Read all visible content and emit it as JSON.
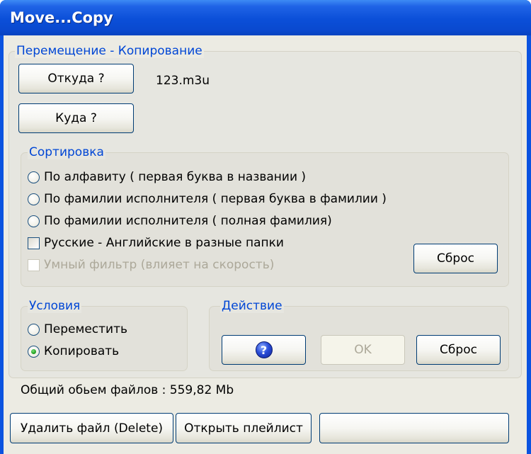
{
  "window": {
    "title": "Move...Copy"
  },
  "move_copy": {
    "legend": "Перемещение - Копирование",
    "from_button": "Откуда ?",
    "from_value": "123.m3u",
    "to_button": "Куда ?"
  },
  "sorting": {
    "legend": "Сортировка",
    "options": [
      {
        "label": "По алфавиту ( первая буква в названии )",
        "selected": false
      },
      {
        "label": "По фамилии исполнителя ( первая буква в фамилии )",
        "selected": false
      },
      {
        "label": "По фамилии исполнителя ( полная фамилия)",
        "selected": false
      }
    ],
    "russian_english_checkbox": {
      "label": "Русские - Английские в разные папки",
      "checked": false
    },
    "smart_filter_checkbox": {
      "label": "Умный фильтр (влияет на скорость)",
      "checked": false,
      "enabled": false
    },
    "reset_button": "Сброс"
  },
  "conditions": {
    "legend": "Условия",
    "options": [
      {
        "label": "Переместить",
        "selected": false
      },
      {
        "label": "Копировать",
        "selected": true
      }
    ]
  },
  "action": {
    "legend": "Действие",
    "help_icon": "question-icon",
    "help_glyph": "?",
    "ok_button": "OK",
    "reset_button": "Сброс"
  },
  "status": {
    "total_size": "Общий обьем файлов : 559,82 Mb"
  },
  "bottom": {
    "delete_button": "Удалить файл (Delete)",
    "open_playlist_button": "Открыть плейлист",
    "empty_button": ""
  },
  "colors": {
    "title_bar": "#0b4fd8",
    "legend_text": "#0046d5",
    "radio_selected": "#21a121"
  }
}
